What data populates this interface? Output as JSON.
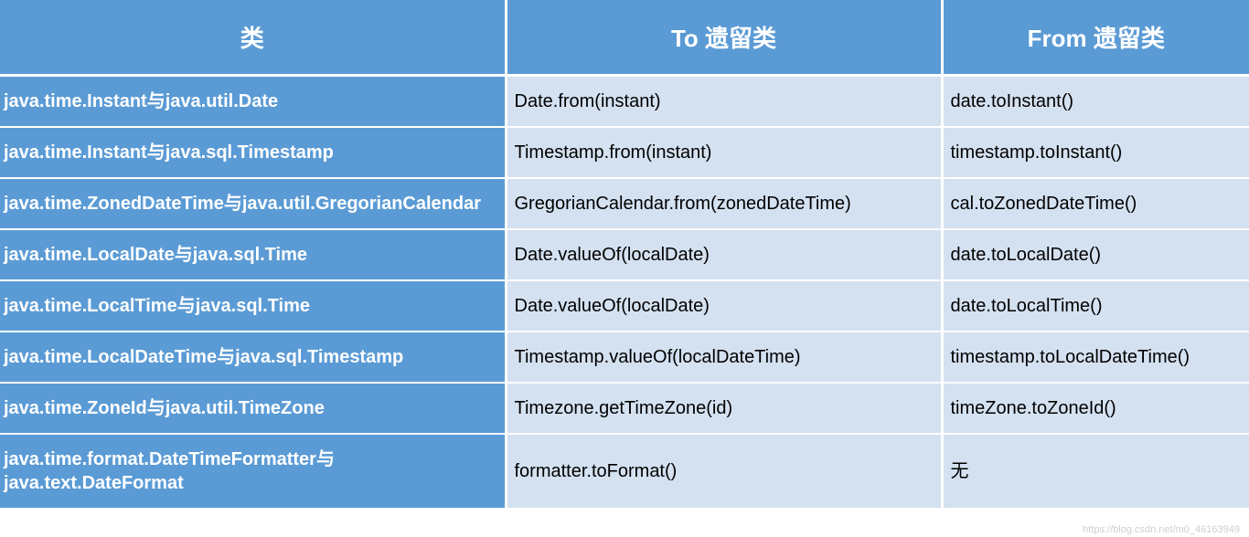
{
  "headers": {
    "class": "类",
    "to": "To 遗留类",
    "from": "From 遗留类"
  },
  "rows": [
    {
      "class": "java.time.Instant与java.util.Date",
      "to": "Date.from(instant)",
      "from": "date.toInstant()"
    },
    {
      "class": "java.time.Instant与java.sql.Timestamp",
      "to": "Timestamp.from(instant)",
      "from": "timestamp.toInstant()"
    },
    {
      "class": "java.time.ZonedDateTime与java.util.GregorianCalendar",
      "to": "GregorianCalendar.from(zonedDateTime)",
      "from": "cal.toZonedDateTime()"
    },
    {
      "class": "java.time.LocalDate与java.sql.Time",
      "to": "Date.valueOf(localDate)",
      "from": "date.toLocalDate()"
    },
    {
      "class": "java.time.LocalTime与java.sql.Time",
      "to": "Date.valueOf(localDate)",
      "from": "date.toLocalTime()"
    },
    {
      "class": "java.time.LocalDateTime与java.sql.Timestamp",
      "to": "Timestamp.valueOf(localDateTime)",
      "from": "timestamp.toLocalDateTime()"
    },
    {
      "class": "java.time.ZoneId与java.util.TimeZone",
      "to": "Timezone.getTimeZone(id)",
      "from": "timeZone.toZoneId()"
    },
    {
      "class": "java.time.format.DateTimeFormatter与java.text.DateFormat",
      "to": "formatter.toFormat()",
      "from": "无"
    }
  ],
  "watermark": "https://blog.csdn.net/m0_46163949"
}
